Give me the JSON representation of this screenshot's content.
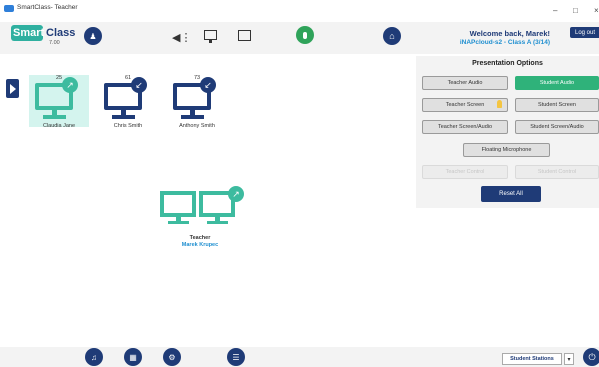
{
  "window": {
    "title": "SmartClass- Teacher",
    "controls": [
      "–",
      "□",
      "×"
    ]
  },
  "header": {
    "logo_smart": "Smart",
    "logo_class": "Class",
    "version": "7.00",
    "welcome": "Welcome back, Marek!",
    "class_info": "iNAPcloud-s2 - Class A (3/14)",
    "logout": "Log out",
    "icons": [
      "user-network-icon",
      "volume-icon",
      "monitor-icon",
      "chat-icon",
      "microphone-icon",
      "home-icon"
    ]
  },
  "students": [
    {
      "number": "25",
      "name": "Claudia Jane",
      "active": true,
      "arrow": "↗"
    },
    {
      "number": "61",
      "name": "Chris Smith",
      "active": false,
      "arrow": "↙"
    },
    {
      "number": "73",
      "name": "Anthony Smith",
      "active": false,
      "arrow": "↙"
    }
  ],
  "teacher": {
    "label": "Teacher",
    "name": "Marek Krupec",
    "arrow": "↗"
  },
  "presentation_options": {
    "title": "Presentation Options",
    "buttons": [
      {
        "label": "Teacher Audio",
        "state": "off"
      },
      {
        "label": "Student Audio",
        "state": "on"
      },
      {
        "label": "Teacher Screen",
        "state": "off"
      },
      {
        "label": "Student Screen",
        "state": "off"
      },
      {
        "label": "Teacher Screen/Audio",
        "state": "off"
      },
      {
        "label": "Student Screen/Audio",
        "state": "off"
      },
      {
        "label": "Floating Microphone",
        "state": "off"
      },
      {
        "label": "Teacher Control",
        "state": "disabled"
      },
      {
        "label": "Student Control",
        "state": "disabled"
      }
    ],
    "reset": "Reset All"
  },
  "footer": {
    "icons": [
      "headset-icon",
      "grid-icon",
      "settings-icon",
      "list-icon",
      "power-icon"
    ],
    "stations_select": "Student Stations",
    "caret": "▾"
  },
  "colors": {
    "primary": "#1f3b77",
    "accent": "#3dbb9f",
    "active_button": "#2fb27a",
    "link": "#1f8fd0"
  }
}
